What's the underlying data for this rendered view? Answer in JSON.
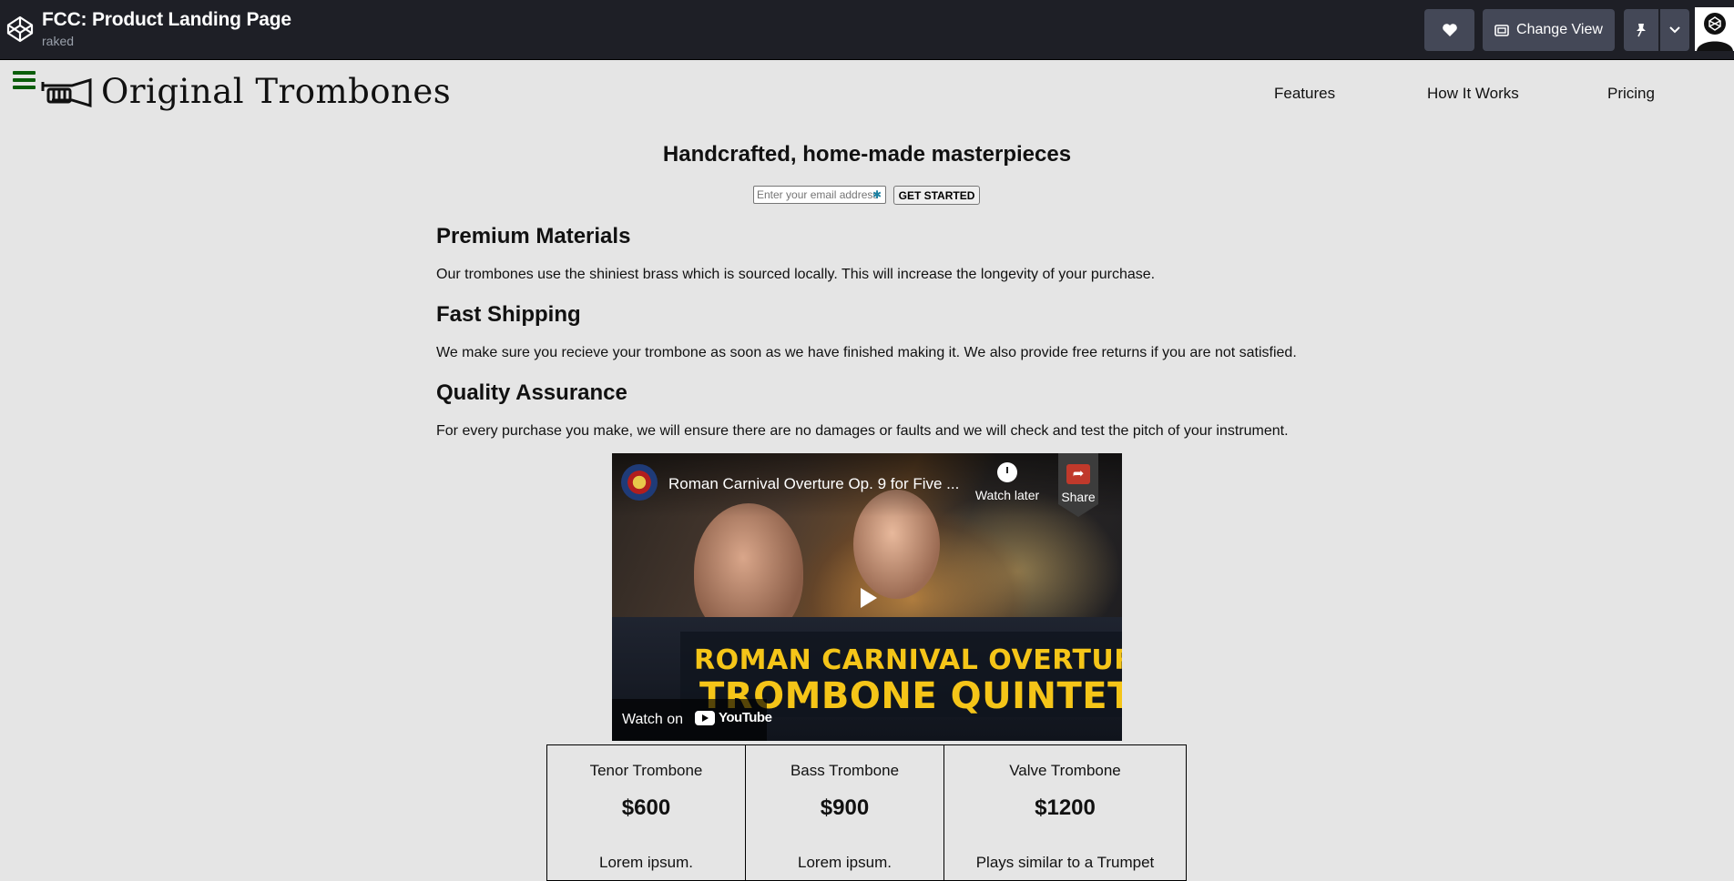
{
  "codepen": {
    "pen_title": "FCC: Product Landing Page",
    "author": "raked",
    "change_view_label": "Change View"
  },
  "header": {
    "brand": "Original Trombones",
    "nav": [
      "Features",
      "How It Works",
      "Pricing"
    ]
  },
  "hero": {
    "title": "Handcrafted, home-made masterpieces",
    "email_placeholder": "Enter your email address",
    "button_label": "GET STARTED"
  },
  "features": [
    {
      "title": "Premium Materials",
      "text": "Our trombones use the shiniest brass which is sourced locally. This will increase the longevity of your purchase."
    },
    {
      "title": "Fast Shipping",
      "text": "We make sure you recieve your trombone as soon as we have finished making it. We also provide free returns if you are not satisfied."
    },
    {
      "title": "Quality Assurance",
      "text": "For every purchase you make, we will ensure there are no damages or faults and we will check and test the pitch of your instrument."
    }
  ],
  "video": {
    "title": "Roman Carnival Overture Op. 9 for Five ...",
    "watch_later": "Watch later",
    "share": "Share",
    "banner_line1": "ROMAN CARNIVAL OVERTURE",
    "banner_line2": "TROMBONE QUINTET",
    "watch_on": "Watch on",
    "youtube": "YouTube"
  },
  "pricing": [
    {
      "name": "Tenor Trombone",
      "price": "$600",
      "desc": "Lorem ipsum."
    },
    {
      "name": "Bass Trombone",
      "price": "$900",
      "desc": "Lorem ipsum."
    },
    {
      "name": "Valve Trombone",
      "price": "$1200",
      "desc": "Plays similar to a Trumpet"
    }
  ],
  "colors": {
    "codepen_bar": "#1e1f26",
    "codepen_button": "#444857",
    "page_background": "#e5e5e5",
    "hamburger": "#0b5d0b",
    "video_banner_text": "#f5c518"
  }
}
